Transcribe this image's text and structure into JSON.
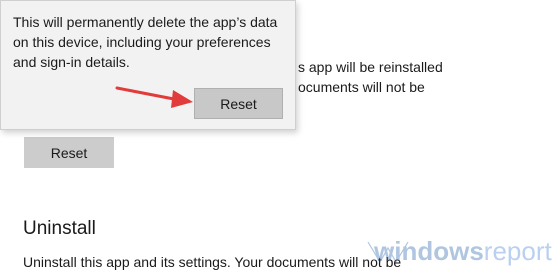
{
  "background": {
    "reset_desc_line1": "s app will be reinstalled",
    "reset_desc_line2": "ocuments will not be",
    "reset_button_label": "Reset"
  },
  "flyout": {
    "message": "This will permanently delete the app’s data on this device, including your preferences and sign-in details.",
    "reset_button_label": "Reset"
  },
  "uninstall": {
    "title": "Uninstall",
    "description": "Uninstall this app and its settings. Your documents will not be"
  },
  "watermark": {
    "text_part1": "windows",
    "text_part2": "report"
  },
  "colors": {
    "arrow": "#e23b3b",
    "button_bg": "#cccccc",
    "flyout_bg": "#f2f2f2"
  }
}
